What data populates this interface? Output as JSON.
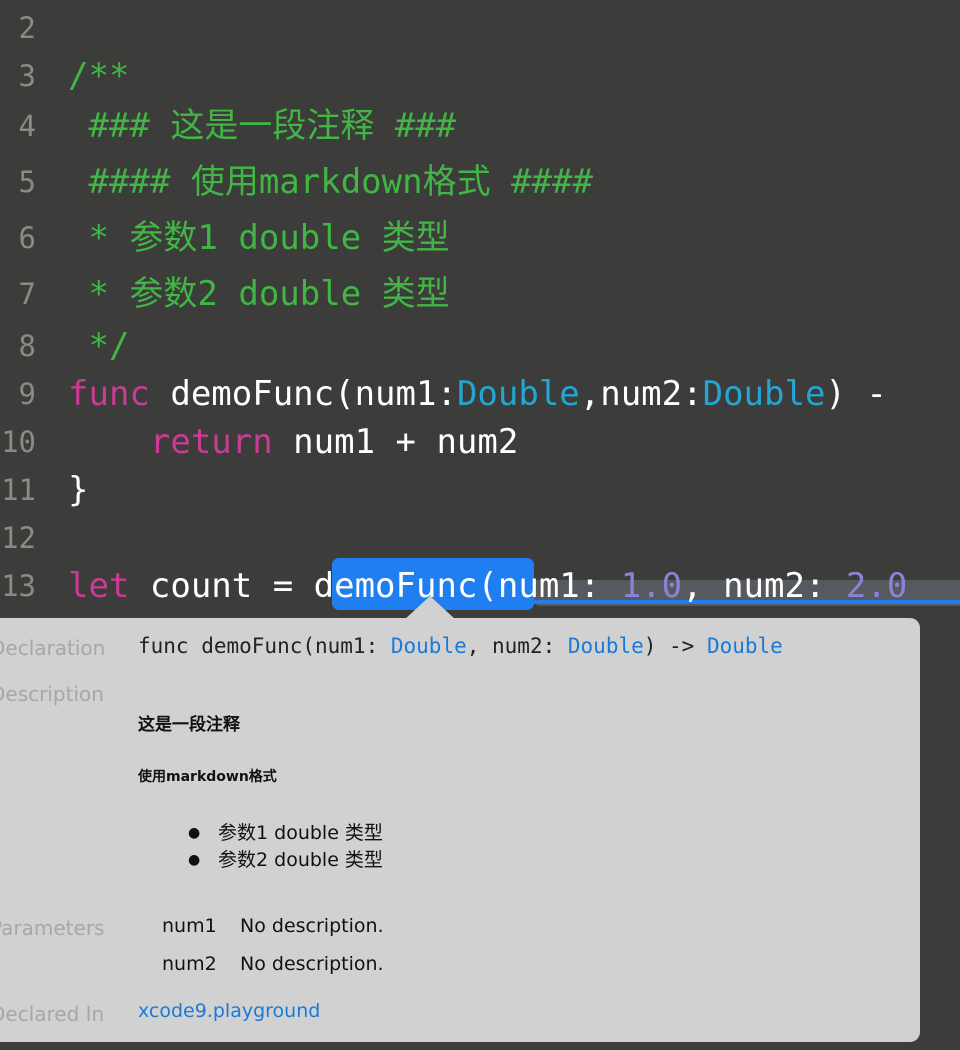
{
  "editor": {
    "lines": [
      {
        "num": "2",
        "tokens": []
      },
      {
        "num": "3",
        "tokens": [
          {
            "t": "/**",
            "c": "comment"
          }
        ]
      },
      {
        "num": "4",
        "tokens": [
          {
            "t": " ### 这是一段注释 ###",
            "c": "comment"
          }
        ]
      },
      {
        "num": "5",
        "tokens": [
          {
            "t": " #### 使用markdown格式 ####",
            "c": "comment"
          }
        ]
      },
      {
        "num": "6",
        "tokens": [
          {
            "t": " * 参数1 double 类型",
            "c": "comment"
          }
        ]
      },
      {
        "num": "7",
        "tokens": [
          {
            "t": " * 参数2 double 类型",
            "c": "comment"
          }
        ]
      },
      {
        "num": "8",
        "tokens": [
          {
            "t": " */",
            "c": "comment"
          }
        ]
      },
      {
        "num": "9",
        "tokens": [
          {
            "t": "func",
            "c": "kw"
          },
          {
            "t": " demoFunc(num1:",
            "c": "plain"
          },
          {
            "t": "Double",
            "c": "type"
          },
          {
            "t": ",num2:",
            "c": "plain"
          },
          {
            "t": "Double",
            "c": "type"
          },
          {
            "t": ") -",
            "c": "plain"
          }
        ]
      },
      {
        "num": "10",
        "tokens": [
          {
            "t": "    return",
            "c": "kw"
          },
          {
            "t": " num1 + num2",
            "c": "plain"
          }
        ]
      },
      {
        "num": "11",
        "tokens": [
          {
            "t": "}",
            "c": "plain"
          }
        ]
      },
      {
        "num": "12",
        "tokens": []
      },
      {
        "num": "13",
        "tokens": [
          {
            "t": "let",
            "c": "kw"
          },
          {
            "t": " count = demoFunc(num1: ",
            "c": "plain"
          },
          {
            "t": "1.0",
            "c": "num"
          },
          {
            "t": ", num2: ",
            "c": "plain"
          },
          {
            "t": "2.0",
            "c": "num"
          }
        ]
      }
    ]
  },
  "popup": {
    "declaration_label": "Declaration",
    "declaration": [
      {
        "t": "func demoFunc(num1: ",
        "c": "plain"
      },
      {
        "t": "Double",
        "c": "type"
      },
      {
        "t": ", num2: ",
        "c": "plain"
      },
      {
        "t": "Double",
        "c": "type"
      },
      {
        "t": ") -> ",
        "c": "plain"
      },
      {
        "t": "Double",
        "c": "type"
      }
    ],
    "description_label": "Description",
    "heading1": "这是一段注释",
    "heading2": "使用markdown格式",
    "bullets": [
      "参数1 double 类型",
      "参数2 double 类型"
    ],
    "parameters_label": "Parameters",
    "parameters": [
      {
        "name": "num1",
        "desc": "No description."
      },
      {
        "name": "num2",
        "desc": "No description."
      }
    ],
    "declared_in_label": "Declared In",
    "declared_in": "xcode9.playground"
  },
  "colors": {
    "background": "#3c3c3a",
    "comment": "#41b645",
    "keyword": "#c93b95",
    "type": "#25a5d3",
    "number": "#8b83d6",
    "selection": "#1f7ef0",
    "link": "#1b7ad8"
  }
}
